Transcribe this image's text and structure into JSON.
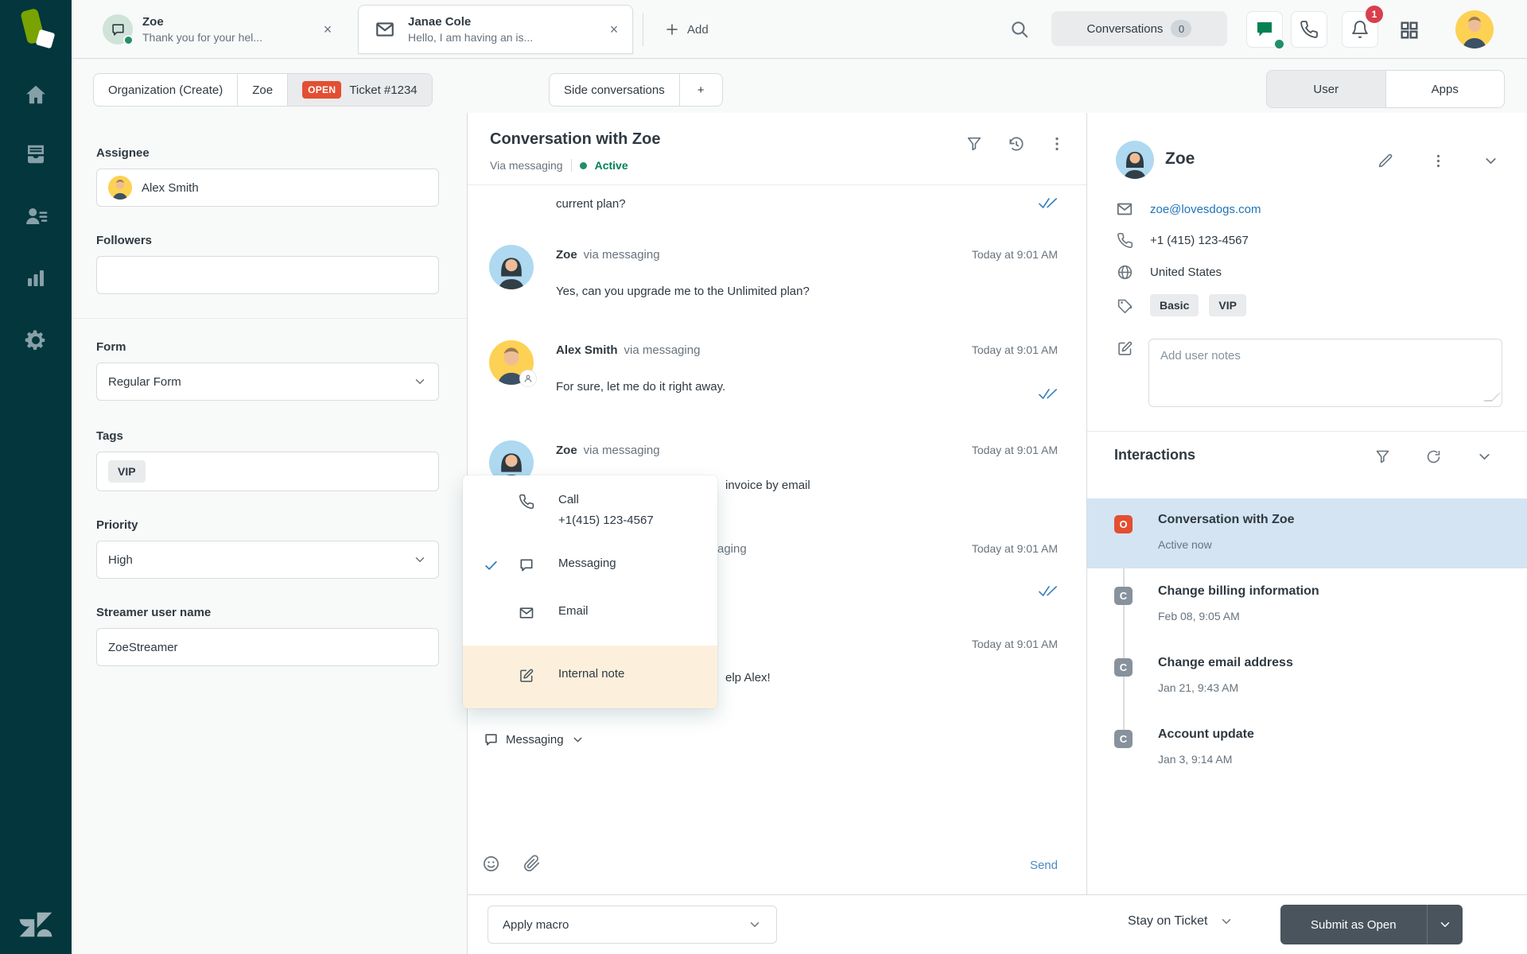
{
  "topbar": {
    "tabs": [
      {
        "title": "Zoe",
        "subtitle": "Thank you for your hel...",
        "close": "×"
      },
      {
        "title": "Janae Cole",
        "subtitle": "Hello, I am having an is...",
        "close": "×"
      }
    ],
    "add_label": "Add",
    "conversations_label": "Conversations",
    "conversations_count": "0",
    "notification_count": "1"
  },
  "breadcrumb": {
    "organization": "Organization (Create)",
    "requester": "Zoe",
    "status_badge": "OPEN",
    "ticket": "Ticket #1234",
    "side_conversations": "Side conversations",
    "plus": "+"
  },
  "panel_tabs": {
    "user": "User",
    "apps": "Apps"
  },
  "ticket_fields": {
    "assignee_label": "Assignee",
    "assignee_value": "Alex Smith",
    "followers_label": "Followers",
    "form_label": "Form",
    "form_value": "Regular Form",
    "tags_label": "Tags",
    "tags": [
      "VIP"
    ],
    "priority_label": "Priority",
    "priority_value": "High",
    "streamer_label": "Streamer user name",
    "streamer_value": "ZoeStreamer"
  },
  "conversation": {
    "title": "Conversation with Zoe",
    "via": "Via messaging",
    "status": "Active",
    "messages": [
      {
        "text": "current plan?"
      },
      {
        "author": "Zoe",
        "via": "via messaging",
        "time": "Today at 9:01 AM",
        "text": "Yes, can you upgrade me to the Unlimited plan?"
      },
      {
        "author": "Alex Smith",
        "via": "via messaging",
        "time": "Today at 9:01 AM",
        "text": "For sure, let me do it right away."
      },
      {
        "author": "Zoe",
        "via": "via messaging",
        "time": "Today at 9:01 AM",
        "text": "invoice by email"
      },
      {
        "via_fragment": "aging",
        "time": "Today at 9:01 AM"
      },
      {
        "time": "Today at 9:01 AM",
        "text": "elp Alex!"
      }
    ],
    "composer": {
      "channel": "Messaging",
      "send_label": "Send"
    }
  },
  "channel_menu": {
    "call_label": "Call",
    "call_number": "+1(415) 123-4567",
    "messaging_label": "Messaging",
    "email_label": "Email",
    "internal_note_label": "Internal note"
  },
  "customer": {
    "name": "Zoe",
    "email": "zoe@lovesdogs.com",
    "phone": "+1 (415) 123-4567",
    "country": "United States",
    "tags": [
      "Basic",
      "VIP"
    ],
    "notes_placeholder": "Add user notes"
  },
  "interactions": {
    "title": "Interactions",
    "items": [
      {
        "badge": "O",
        "title": "Conversation with Zoe",
        "subtitle": "Active now"
      },
      {
        "badge": "C",
        "title": "Change billing information",
        "subtitle": "Feb 08, 9:05 AM"
      },
      {
        "badge": "C",
        "title": "Change email address",
        "subtitle": "Jan 21, 9:43 AM"
      },
      {
        "badge": "C",
        "title": "Account update",
        "subtitle": "Jan 3, 9:14 AM"
      }
    ]
  },
  "footer": {
    "apply_macro": "Apply macro",
    "stay_label": "Stay on Ticket",
    "submit_label": "Submit as Open"
  }
}
